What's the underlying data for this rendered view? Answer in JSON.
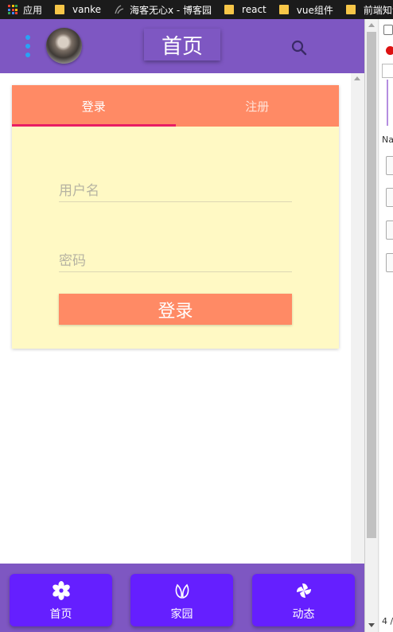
{
  "bookmarks": {
    "apps": "应用",
    "items": [
      "vanke",
      "海客无心x - 博客园",
      "react",
      "vue组件",
      "前端知识"
    ]
  },
  "header": {
    "title": "首页"
  },
  "card": {
    "tabs": [
      "登录",
      "注册"
    ],
    "username_placeholder": "用户名",
    "password_placeholder": "密码",
    "login_button": "登录"
  },
  "bottom_nav": [
    {
      "label": "首页",
      "icon": "flower-icon"
    },
    {
      "label": "家园",
      "icon": "leaf-icon"
    },
    {
      "label": "动态",
      "icon": "pinwheel-icon"
    }
  ],
  "devtools": {
    "name_label": "Na",
    "page_indicator": "4 /"
  },
  "colors": {
    "appbar": "#7e57c2",
    "tab_bar": "#ff8a65",
    "tab_indicator": "#e91e63",
    "card_bg": "#fff9c4",
    "nav_button": "#651fff",
    "menu_dots": "#29a3f5"
  }
}
